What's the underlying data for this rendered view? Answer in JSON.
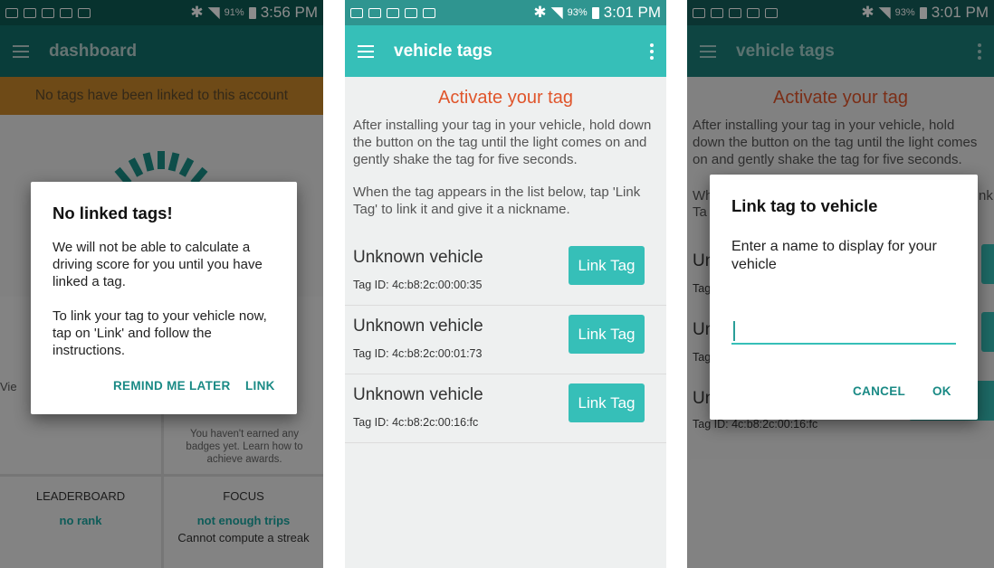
{
  "screen1": {
    "status": {
      "battery": "91%",
      "time": "3:56 PM"
    },
    "appbar_title": "dashboard",
    "notice": "No tags have been linked to this account",
    "view_text": "Vie",
    "badges_text": "You haven't earned any badges yet. Learn how to achieve awards.",
    "leaderboard": {
      "header": "LEADERBOARD",
      "value": "no rank"
    },
    "focus": {
      "header": "FOCUS",
      "value": "not enough trips",
      "sub": "Cannot compute a streak"
    },
    "dialog": {
      "title": "No linked tags!",
      "body1": "We will not be able to calculate a driving score for you until you have linked a tag.",
      "body2": "To link your tag to your vehicle now, tap on 'Link' and follow the instructions.",
      "btn_later": "REMIND ME LATER",
      "btn_link": "LINK"
    }
  },
  "screen2": {
    "status": {
      "battery": "93%",
      "time": "3:01 PM"
    },
    "appbar_title": "vehicle tags",
    "heading": "Activate your tag",
    "instruction1": "After installing your tag in your vehicle, hold down the button on the tag until the light comes on and gently shake the tag for five seconds.",
    "instruction2": "When the tag appears in the list below, tap 'Link Tag' to link it and give it a nickname.",
    "tags": [
      {
        "name": "Unknown vehicle",
        "id": "Tag ID: 4c:b8:2c:00:00:35",
        "button": "Link Tag"
      },
      {
        "name": "Unknown vehicle",
        "id": "Tag ID: 4c:b8:2c:00:01:73",
        "button": "Link Tag"
      },
      {
        "name": "Unknown vehicle",
        "id": "Tag ID: 4c:b8:2c:00:16:fc",
        "button": "Link Tag"
      }
    ]
  },
  "screen3": {
    "status": {
      "battery": "93%",
      "time": "3:01 PM"
    },
    "appbar_title": "vehicle tags",
    "heading": "Activate your tag",
    "instruction1": "After installing your tag in your vehicle, hold down the button on the tag until the light comes on and gently shake the tag for five seconds.",
    "bg_fragments": {
      "wh": "Wh",
      "ta": "Ta",
      "nk": "nk",
      "un": "Un",
      "tag": "Tag",
      "tag_id": "Tag ID: 4c:b8:2c:00:16:fc"
    },
    "dialog": {
      "title": "Link tag to vehicle",
      "prompt": "Enter a name to display for your vehicle",
      "input_value": "",
      "btn_cancel": "CANCEL",
      "btn_ok": "OK"
    }
  },
  "colors": {
    "teal": "#36bfb8",
    "dark_teal": "#12706a",
    "notice": "#c8882a",
    "orange_heading": "#e0552b"
  }
}
